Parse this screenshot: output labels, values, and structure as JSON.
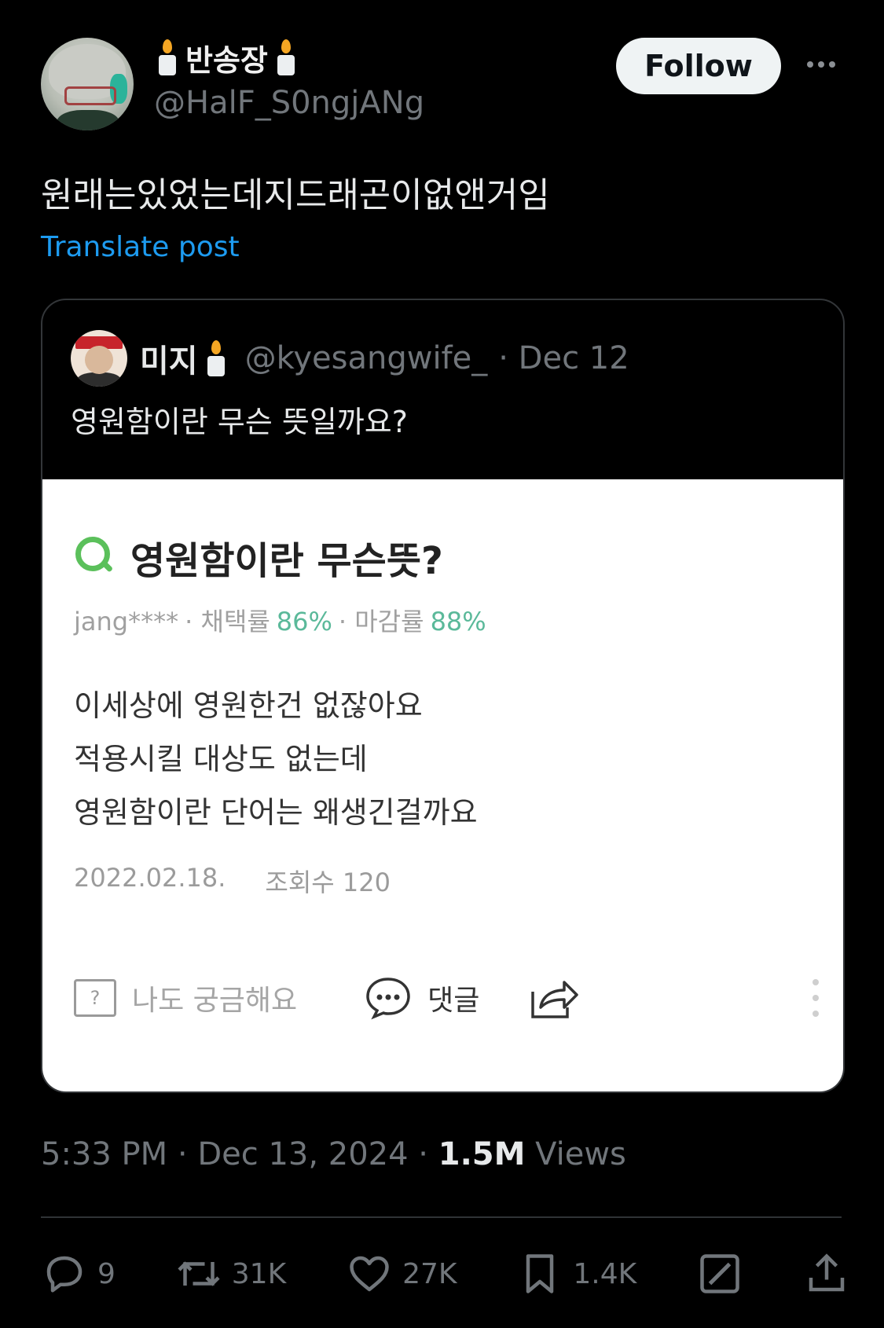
{
  "author": {
    "display_name": "반송장",
    "handle": "@HalF_S0ngjANg",
    "follow_label": "Follow"
  },
  "post": {
    "text": "원래는있었는데지드래곤이없앤거임",
    "translate_label": "Translate post",
    "time": "5:33 PM",
    "date": "Dec 13, 2024",
    "views_count": "1.5M",
    "views_label": "Views"
  },
  "quoted": {
    "display_name": "미지",
    "handle": "@kyesangwife_",
    "date": "· Dec 12",
    "text": "영원함이란 무슨 뜻일까요?",
    "image": {
      "title": "영원함이란 무슨뜻?",
      "meta_user": "jang****",
      "meta_adopt_label": "· 채택률",
      "meta_adopt_value": "86%",
      "meta_close_label": "· 마감률",
      "meta_close_value": "88%",
      "body_lines": [
        "이세상에 영원한건 없잖아요",
        "적용시킬 대상도 없는데",
        "영원함이란 단어는 왜생긴걸까요"
      ],
      "date": "2022.02.18.",
      "views": "조회수 120",
      "curious_label": "나도 궁금해요",
      "comment_label": "댓글",
      "question_mark": "?"
    }
  },
  "engagement": {
    "replies": "9",
    "reposts": "31K",
    "likes": "27K",
    "bookmarks": "1.4K"
  },
  "colors": {
    "background": "#000000",
    "link_blue": "#1d9bf0",
    "muted": "#71767b",
    "naver_green": "#5bc05b"
  }
}
